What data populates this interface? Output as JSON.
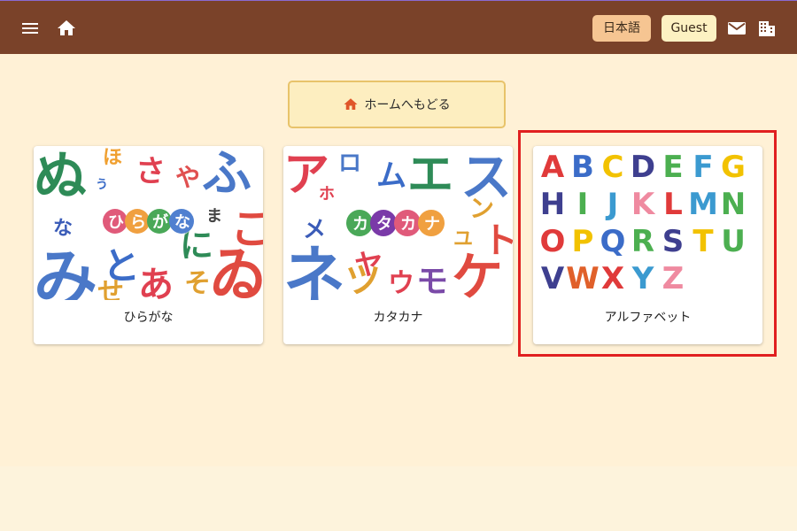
{
  "header": {
    "menu_icon": "menu-icon",
    "home_icon": "home-icon",
    "language_label": "日本語",
    "guest_label": "Guest",
    "mail_icon": "mail-icon",
    "building_icon": "building-icon",
    "bar_color": "#7a4229"
  },
  "main": {
    "back_button_label": "ホームへもどる",
    "back_button_icon": "home-icon",
    "cards": [
      {
        "label": "ひらがな",
        "badge": "ひらがな"
      },
      {
        "label": "カタカナ",
        "badge": "カタカナ"
      },
      {
        "label": "アルファベット",
        "letters": [
          "A",
          "B",
          "C",
          "D",
          "E",
          "F",
          "G",
          "H",
          "I",
          "J",
          "K",
          "L",
          "M",
          "N",
          "O",
          "P",
          "Q",
          "R",
          "S",
          "T",
          "U",
          "V",
          "W",
          "X",
          "Y",
          "Z"
        ]
      }
    ],
    "selected_card": "アルファベット"
  }
}
